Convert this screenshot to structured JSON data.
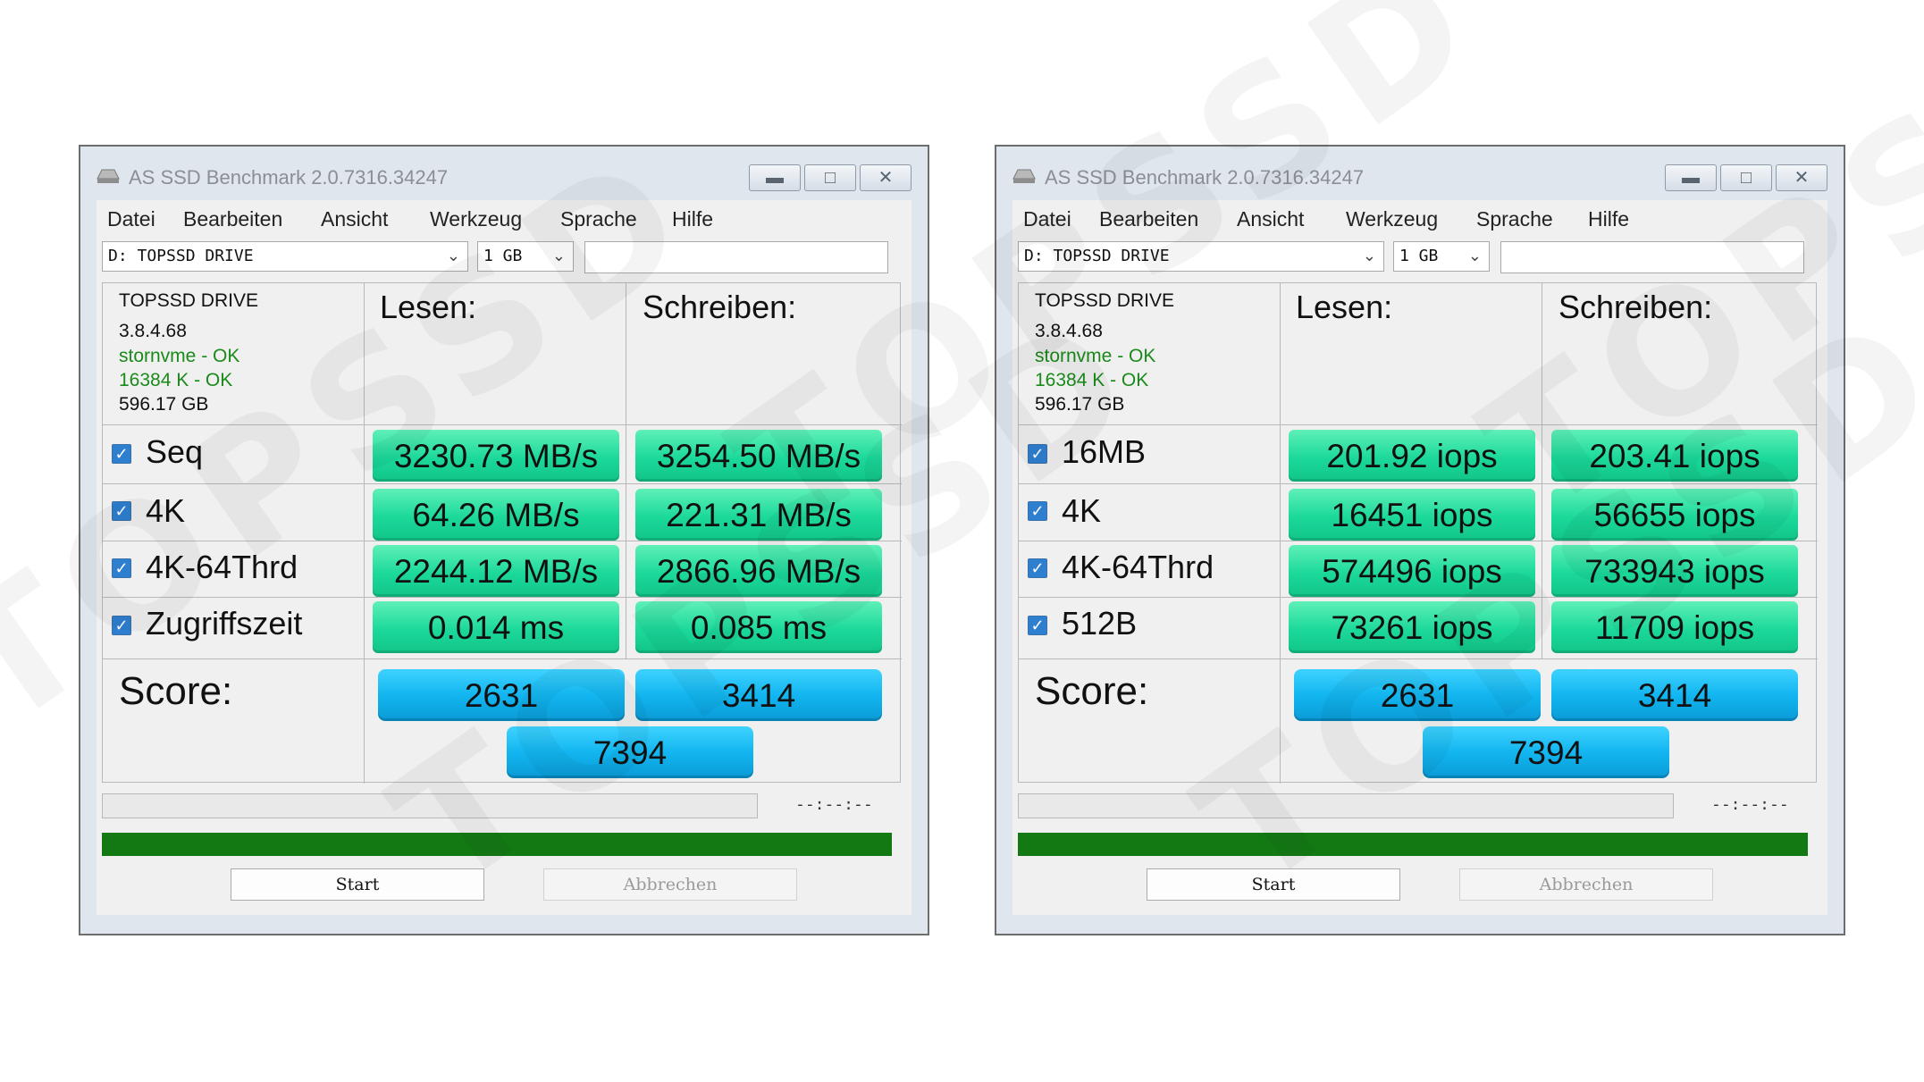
{
  "windows": [
    {
      "title": "AS SSD Benchmark 2.0.7316.34247",
      "menu": [
        "Datei",
        "Bearbeiten",
        "Ansicht",
        "Werkzeug",
        "Sprache",
        "Hilfe"
      ],
      "drive_select": "D: TOPSSD DRIVE",
      "size_select": "1 GB",
      "info": {
        "name": "TOPSSD DRIVE",
        "firmware": "3.8.4.68",
        "driver": "stornvme - OK",
        "alignment": "16384 K - OK",
        "capacity": "596.17 GB"
      },
      "read_label": "Lesen:",
      "write_label": "Schreiben:",
      "rows": [
        {
          "label": "Seq",
          "read": "3230.73 MB/s",
          "write": "3254.50 MB/s"
        },
        {
          "label": "4K",
          "read": "64.26 MB/s",
          "write": "221.31 MB/s"
        },
        {
          "label": "4K-64Thrd",
          "read": "2244.12 MB/s",
          "write": "2866.96 MB/s"
        },
        {
          "label": "Zugriffszeit",
          "read": "0.014 ms",
          "write": "0.085 ms"
        }
      ],
      "score_label": "Score:",
      "score_read": "2631",
      "score_write": "3414",
      "score_total": "7394",
      "elapsed": "--:--:--",
      "start_label": "Start",
      "cancel_label": "Abbrechen"
    },
    {
      "title": "AS SSD Benchmark 2.0.7316.34247",
      "menu": [
        "Datei",
        "Bearbeiten",
        "Ansicht",
        "Werkzeug",
        "Sprache",
        "Hilfe"
      ],
      "drive_select": "D: TOPSSD DRIVE",
      "size_select": "1 GB",
      "info": {
        "name": "TOPSSD DRIVE",
        "firmware": "3.8.4.68",
        "driver": "stornvme - OK",
        "alignment": "16384 K - OK",
        "capacity": "596.17 GB"
      },
      "read_label": "Lesen:",
      "write_label": "Schreiben:",
      "rows": [
        {
          "label": "16MB",
          "read": "201.92 iops",
          "write": "203.41 iops"
        },
        {
          "label": "4K",
          "read": "16451 iops",
          "write": "56655 iops"
        },
        {
          "label": "4K-64Thrd",
          "read": "574496 iops",
          "write": "733943 iops"
        },
        {
          "label": "512B",
          "read": "73261 iops",
          "write": "11709 iops"
        }
      ],
      "score_label": "Score:",
      "score_read": "2631",
      "score_write": "3414",
      "score_total": "7394",
      "elapsed": "--:--:--",
      "start_label": "Start",
      "cancel_label": "Abbrechen"
    }
  ],
  "watermark_text": "TOPSSD",
  "colors": {
    "result_cell": "#1bd99a",
    "score_cell": "#12b6f0",
    "progress": "#137a13",
    "status_ok": "#1a8a1a"
  }
}
